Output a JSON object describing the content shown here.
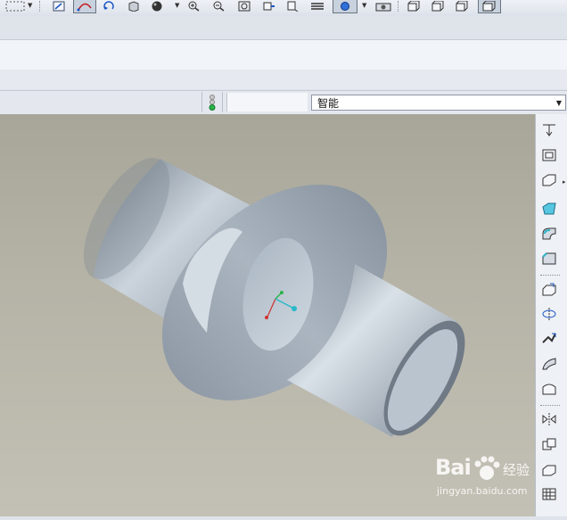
{
  "toolbar": {
    "icons": [
      "select-box-icon",
      "dropdown-arrow-icon",
      "sketch-icon",
      "datum-curve-icon",
      "spin-view-icon",
      "orient-view-icon",
      "shading-sphere-icon",
      "zoom-in-icon",
      "zoom-out-icon",
      "refit-icon",
      "view-manager-icon",
      "layers-icon",
      "datum-point-icon",
      "camera-icon",
      "front-view-icon",
      "back-view-icon",
      "right-view-icon",
      "left-view-icon"
    ]
  },
  "status_bar": {
    "selection_filter": {
      "selected": "智能"
    }
  },
  "right_toolbar": {
    "icons": [
      "hole-icon",
      "shell-icon",
      "rib-icon",
      "draft-icon",
      "round-icon",
      "chamfer-icon",
      "extrude-icon",
      "revolve-icon",
      "sweep-icon",
      "blend-icon",
      "boundary-blend-icon",
      "mirror-icon",
      "merge-icon",
      "trim-icon",
      "pattern-icon"
    ]
  },
  "viewport": {
    "model": "intersecting-tubes",
    "background_top": "#a8a699",
    "background_bottom": "#c3c1b5",
    "surface_color": "#aeb9c4"
  },
  "watermark": {
    "brand": "Bai",
    "brand_suffix": "经验",
    "url": "jingyan.baidu.com"
  }
}
